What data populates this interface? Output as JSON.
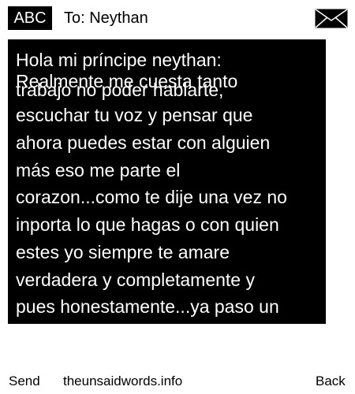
{
  "header": {
    "abc_label": "ABC",
    "to_label": "To: Neythan",
    "envelope_icon": "envelope-icon"
  },
  "message": {
    "lines": [
      "Hola mi príncipe neythan:",
      "Realmente me cuesta tanto",
      "trabajo no poder hablarte,",
      "escuchar tu voz y pensar que",
      "ahora puedes estar con alguien",
      "más eso me parte el",
      "corazon...como te dije una vez no",
      "inporta lo que hagas o con quien",
      "estes yo siempre te amare",
      "verdadera y completamente y",
      "pues honestamente...ya paso un"
    ]
  },
  "footer": {
    "send_label": "Send",
    "site_label": "theunsaidwords.info",
    "back_label": "Back"
  },
  "colors": {
    "background": "#ffffff",
    "panel": "#000000",
    "text_on_panel": "#ffffff"
  }
}
